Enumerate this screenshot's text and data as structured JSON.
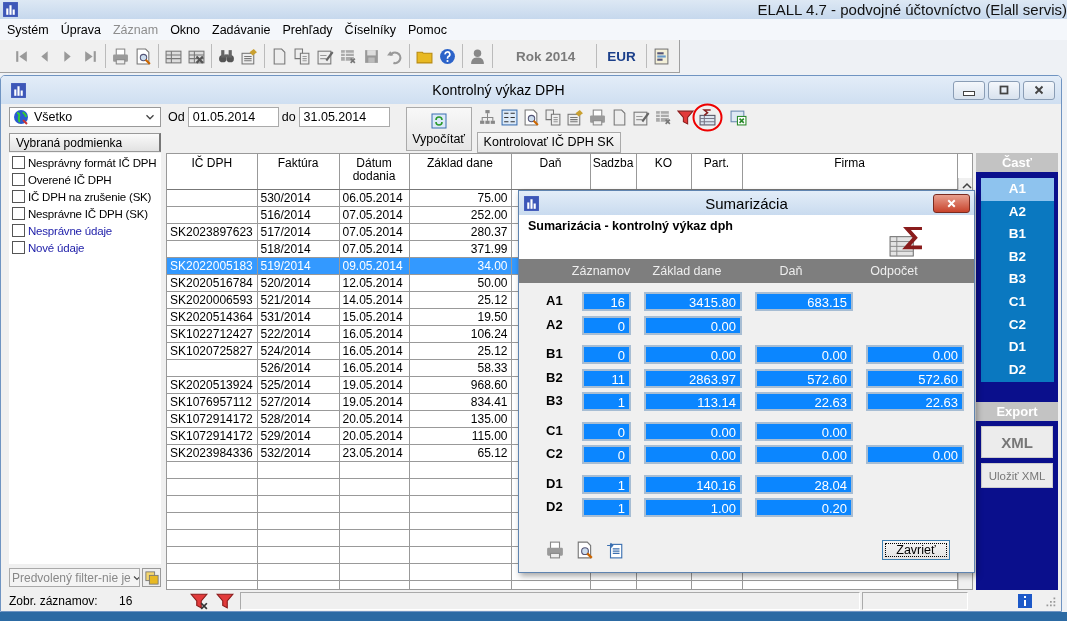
{
  "app": {
    "title": "ELALL 4.7 - podvojné účtovníctvo (Elall servis)"
  },
  "menu": [
    {
      "label": "Systém",
      "disabled": false
    },
    {
      "label": "Úprava",
      "disabled": false
    },
    {
      "label": "Záznam",
      "disabled": true
    },
    {
      "label": "Okno",
      "disabled": false
    },
    {
      "label": "Zadávanie",
      "disabled": false
    },
    {
      "label": "Prehľady",
      "disabled": false
    },
    {
      "label": "Číselníky",
      "disabled": false
    },
    {
      "label": "Pomoc",
      "disabled": false
    }
  ],
  "toolbar": {
    "year": "Rok 2014",
    "currency": "EUR"
  },
  "report_window": {
    "title": "Kontrolný výkaz DPH",
    "filter": "Všetko",
    "from_label": "Od",
    "from": "01.05.2014",
    "to_label": "do",
    "to": "31.05.2014",
    "calculate_button": "Vypočítať",
    "check_button": "Kontrolovať IČ DPH SK"
  },
  "conditions": {
    "header": "Vybraná podmienka",
    "items": [
      {
        "label": "Nesprávny formát IČ DPH",
        "checked": false,
        "kind": "vat"
      },
      {
        "label": "Overené IČ DPH",
        "checked": false,
        "kind": "vat"
      },
      {
        "label": "IČ DPH na zrušenie (SK)",
        "checked": false,
        "kind": "vat"
      },
      {
        "label": "Nesprávne IČ  DPH (SK)",
        "checked": false,
        "kind": "vat"
      },
      {
        "label": "Nesprávne údaje",
        "checked": false,
        "kind": "data"
      },
      {
        "label": "Nové údaje",
        "checked": false,
        "kind": "data"
      }
    ],
    "preset_filter": "Predvolený filter-nie je"
  },
  "grid": {
    "columns": [
      "IČ DPH",
      "Faktúra",
      "Dátum dodania",
      "Základ dane",
      "Daň",
      "Sadzba",
      "KO",
      "Part.",
      "Firma"
    ],
    "rows": [
      {
        "invoice": "530/2014",
        "date": "06.05.2014",
        "base": "75.00",
        "selected": false
      },
      {
        "invoice": "516/2014",
        "date": "07.05.2014",
        "base": "252.00",
        "selected": false
      },
      {
        "vat_id": "SK2023897623",
        "invoice": "517/2014",
        "date": "07.05.2014",
        "base": "280.37",
        "selected": false
      },
      {
        "invoice": "518/2014",
        "date": "07.05.2014",
        "base": "371.99",
        "selected": false
      },
      {
        "vat_id": "SK2022005183",
        "invoice": "519/2014",
        "date": "09.05.2014",
        "base": "34.00",
        "selected": true
      },
      {
        "vat_id": "SK2020516784",
        "invoice": "520/2014",
        "date": "12.05.2014",
        "base": "50.00",
        "selected": false
      },
      {
        "vat_id": "SK2020006593",
        "invoice": "521/2014",
        "date": "14.05.2014",
        "base": "25.12",
        "selected": false
      },
      {
        "vat_id": "SK2020514364",
        "invoice": "531/2014",
        "date": "15.05.2014",
        "base": "19.50",
        "selected": false
      },
      {
        "vat_id": "SK1022712427",
        "invoice": "522/2014",
        "date": "16.05.2014",
        "base": "106.24",
        "selected": false
      },
      {
        "vat_id": "SK1020725827",
        "invoice": "524/2014",
        "date": "16.05.2014",
        "base": "25.12",
        "selected": false
      },
      {
        "invoice": "526/2014",
        "date": "16.05.2014",
        "base": "58.33",
        "selected": false
      },
      {
        "vat_id": "SK2020513924",
        "invoice": "525/2014",
        "date": "19.05.2014",
        "base": "968.60",
        "selected": false
      },
      {
        "vat_id": "SK1076957112",
        "invoice": "527/2014",
        "date": "19.05.2014",
        "base": "834.41",
        "selected": false
      },
      {
        "vat_id": "SK1072914172",
        "invoice": "528/2014",
        "date": "20.05.2014",
        "base": "135.00",
        "selected": false
      },
      {
        "vat_id": "SK1072914172",
        "invoice": "529/2014",
        "date": "20.05.2014",
        "base": "115.00",
        "selected": false
      },
      {
        "vat_id": "SK2023984336",
        "invoice": "532/2014",
        "date": "23.05.2014",
        "base": "65.12",
        "selected": false
      }
    ]
  },
  "parts": {
    "header": "Časť",
    "items": [
      {
        "label": "A1",
        "selected": true
      },
      {
        "label": "A2",
        "selected": false
      },
      {
        "label": "B1",
        "selected": false
      },
      {
        "label": "B2",
        "selected": false
      },
      {
        "label": "B3",
        "selected": false
      },
      {
        "label": "C1",
        "selected": false
      },
      {
        "label": "C2",
        "selected": false
      },
      {
        "label": "D1",
        "selected": false
      },
      {
        "label": "D2",
        "selected": false
      }
    ]
  },
  "export": {
    "header": "Export",
    "buttons": [
      {
        "label": "XML",
        "kind": "primary"
      },
      {
        "label": "Uložiť XML",
        "kind": "secondary"
      }
    ]
  },
  "status_bar": {
    "label": "Zobr. záznamov:",
    "count": "16"
  },
  "summary_dialog": {
    "title": "Sumarizácia",
    "subtitle": "Sumarizácia - kontrolný výkaz dph",
    "columns": [
      "Záznamov",
      "Základ dane",
      "Daň",
      "Odpočet"
    ],
    "groups": [
      {
        "rows": [
          {
            "label": "A1",
            "count": "16",
            "base": "3415.80",
            "tax": "683.15"
          },
          {
            "label": "A2",
            "count": "0",
            "base": "0.00"
          }
        ]
      },
      {
        "rows": [
          {
            "label": "B1",
            "count": "0",
            "base": "0.00",
            "tax": "0.00",
            "deduction": "0.00"
          },
          {
            "label": "B2",
            "count": "11",
            "base": "2863.97",
            "tax": "572.60",
            "deduction": "572.60"
          },
          {
            "label": "B3",
            "count": "1",
            "base": "113.14",
            "tax": "22.63",
            "deduction": "22.63"
          }
        ]
      },
      {
        "rows": [
          {
            "label": "C1",
            "count": "0",
            "base": "0.00",
            "tax": "0.00"
          },
          {
            "label": "C2",
            "count": "0",
            "base": "0.00",
            "tax": "0.00",
            "deduction": "0.00"
          }
        ]
      },
      {
        "rows": [
          {
            "label": "D1",
            "count": "1",
            "base": "140.16",
            "tax": "28.04"
          },
          {
            "label": "D2",
            "count": "1",
            "base": "1.00",
            "tax": "0.20"
          }
        ]
      }
    ],
    "close_button": "Zavrieť"
  }
}
